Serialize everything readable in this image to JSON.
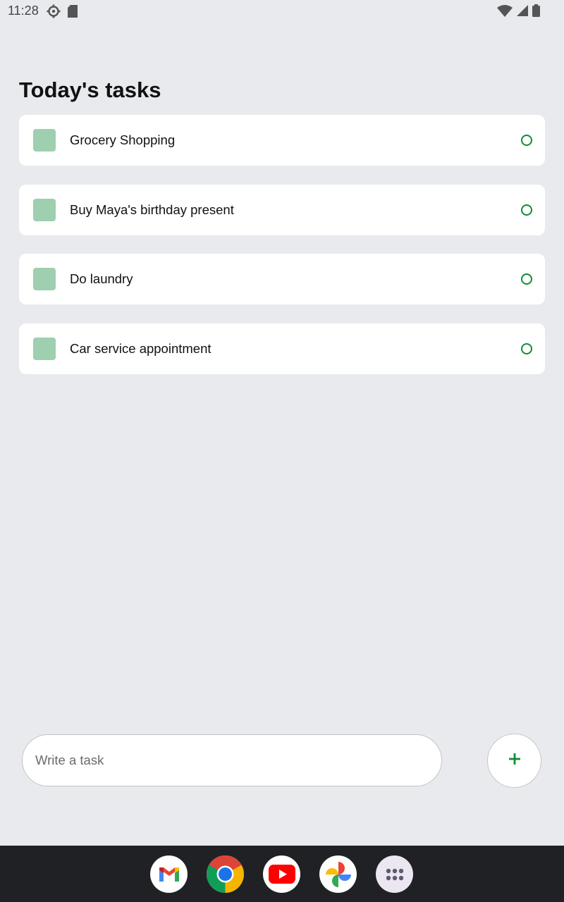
{
  "status_bar": {
    "time": "11:28",
    "icons": [
      "settings-gear-icon",
      "sd-card-icon",
      "wifi-icon",
      "cell-signal-icon",
      "battery-icon"
    ]
  },
  "page": {
    "title": "Today's tasks"
  },
  "tasks": [
    {
      "label": "Grocery Shopping",
      "done": false
    },
    {
      "label": "Buy Maya's birthday present",
      "done": false
    },
    {
      "label": "Do laundry",
      "done": false
    },
    {
      "label": "Car service appointment",
      "done": false
    }
  ],
  "composer": {
    "placeholder": "Write a task",
    "value": ""
  },
  "add_button": {
    "icon": "plus-icon"
  },
  "dock": {
    "apps": [
      "gmail-icon",
      "chrome-icon",
      "youtube-icon",
      "google-photos-icon",
      "app-drawer-icon"
    ]
  },
  "colors": {
    "background": "#E8EAED",
    "card": "#FFFFFF",
    "checkbox": "#9ED0B0",
    "accent_green": "#138A36",
    "dock": "#202124"
  }
}
